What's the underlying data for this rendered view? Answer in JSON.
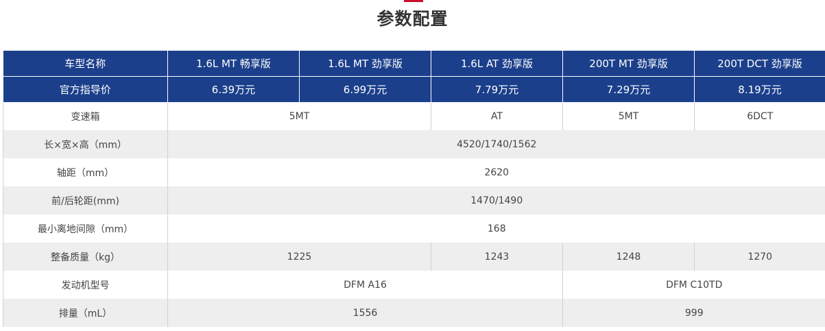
{
  "page_title": "参数配置",
  "header": {
    "label": "车型名称",
    "models": [
      "1.6L MT 畅享版",
      "1.6L MT 劲享版",
      "1.6L AT 劲享版",
      "200T MT 劲享版",
      "200T DCT 劲享版"
    ]
  },
  "price_row": {
    "label": "官方指导价",
    "values": [
      "6.39万元",
      "6.99万元",
      "7.79万元",
      "7.29万元",
      "8.19万元"
    ]
  },
  "rows": {
    "gearbox": {
      "label": "变速箱",
      "v1": "5MT",
      "v2": "AT",
      "v3": "5MT",
      "v4": "6DCT"
    },
    "dimensions": {
      "label": "长×宽×高（mm）",
      "v1": "4520/1740/1562"
    },
    "wheelbase": {
      "label": "轴距（mm）",
      "v1": "2620"
    },
    "track": {
      "label": "前/后轮距(mm)",
      "v1": "1470/1490"
    },
    "ground_clearance": {
      "label": "最小离地间隙（mm）",
      "v1": "168"
    },
    "curb_weight": {
      "label": "整备质量（kg）",
      "v1": "1225",
      "v2": "1243",
      "v3": "1248",
      "v4": "1270"
    },
    "engine_model": {
      "label": "发动机型号",
      "v1": "DFM A16",
      "v2": "DFM C10TD"
    },
    "displacement": {
      "label": "排量（mL）",
      "v1": "1556",
      "v2": "999"
    }
  },
  "colors": {
    "header_bg": "#1b3f8b",
    "stripe": "#eeeeee",
    "accent": "#c8102e"
  }
}
